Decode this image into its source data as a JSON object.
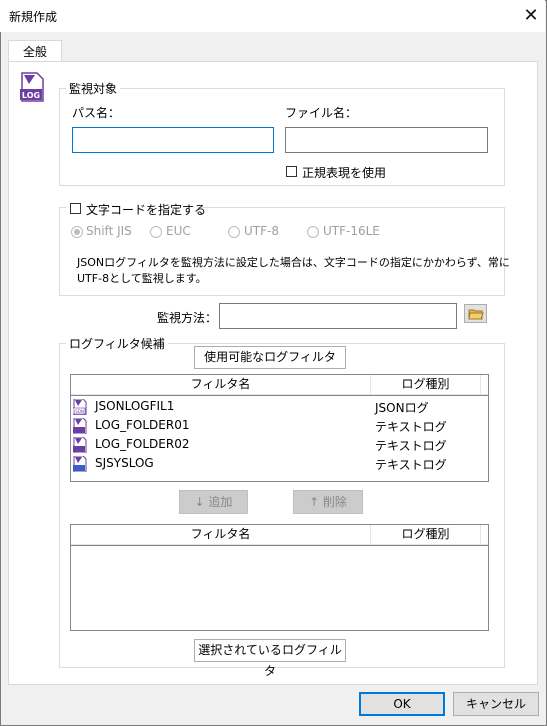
{
  "window": {
    "title": "新規作成",
    "close_glyph": "✕"
  },
  "tab": {
    "label": "全般"
  },
  "monitor_target": {
    "group_title": "監視対象",
    "path_label": "パス名：",
    "path_value": "",
    "file_label": "ファイル名：",
    "file_value": "",
    "regex_label": "正規表現を使用",
    "regex_checked": false
  },
  "charset": {
    "checkbox_label": "文字コードを指定する",
    "checked": false,
    "options": [
      "Shift JIS",
      "EUC",
      "UTF-8",
      "UTF-16LE"
    ],
    "selected": "Shift JIS",
    "note_line1": "JSONログフィルタを監視方法に設定した場合は、文字コードの指定にかかわらず、常に",
    "note_line2": "UTF-8として監視します。"
  },
  "method": {
    "label": "監視方法：",
    "value": ""
  },
  "log_filters": {
    "group_title": "ログフィルタ候補",
    "available_tab": "使用可能なログフィルタ",
    "col_name": "フィルタ名",
    "col_type": "ログ種別",
    "available": [
      {
        "name": "JSONLOGFIL1",
        "type": "JSONログ",
        "icon": "json-log-icon"
      },
      {
        "name": "LOG_FOLDER01",
        "type": "テキストログ",
        "icon": "log-icon"
      },
      {
        "name": "LOG_FOLDER02",
        "type": "テキストログ",
        "icon": "log-icon"
      },
      {
        "name": "SJSYSLOG",
        "type": "テキストログ",
        "icon": "syslog-icon"
      }
    ],
    "add_button": "↓ 追加",
    "remove_button": "↑ 削除",
    "selected_tab": "選択されているログフィルタ"
  },
  "footer": {
    "ok": "OK",
    "cancel": "キャンセル"
  },
  "colors": {
    "accent": "#0078d7",
    "icon_purple": "#6b3fa0",
    "folder": "#e8b74a"
  }
}
